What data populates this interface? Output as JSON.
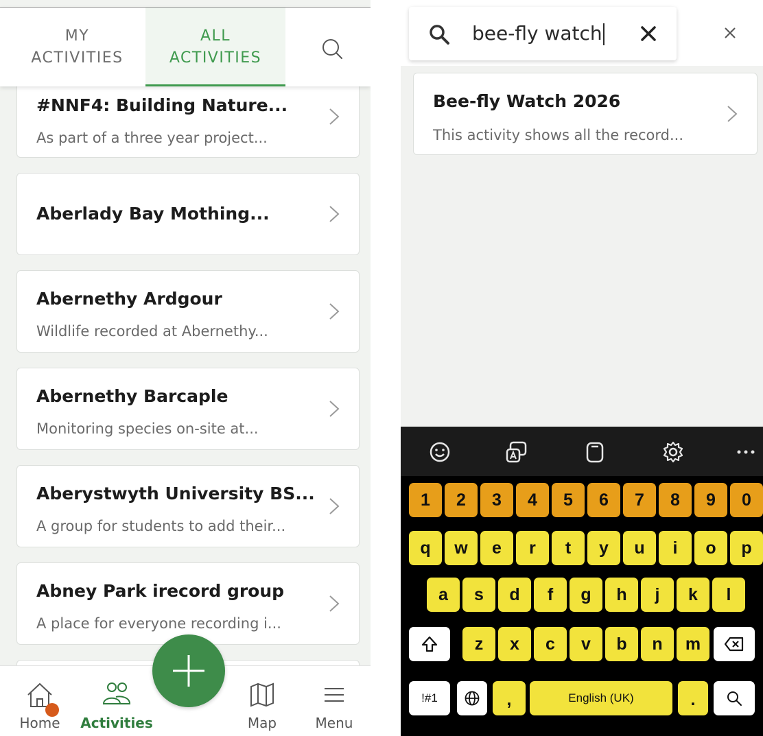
{
  "left": {
    "tabs": {
      "my_line1": "MY",
      "my_line2": "ACTIVITIES",
      "all_line1": "ALL",
      "all_line2": "ACTIVITIES"
    },
    "activities": [
      {
        "title": "#NNF4: Building Nature...",
        "desc": "As part of a three year project..."
      },
      {
        "title": "Aberlady Bay Mothing...",
        "desc": ""
      },
      {
        "title": "Abernethy Ardgour",
        "desc": "Wildlife recorded at Abernethy..."
      },
      {
        "title": "Abernethy Barcaple",
        "desc": "Monitoring species on-site at..."
      },
      {
        "title": "Aberystwyth University BS...",
        "desc": "A group for students to add their..."
      },
      {
        "title": "Abney Park irecord group",
        "desc": "A place for everyone recording i..."
      }
    ],
    "nav": {
      "home": "Home",
      "activities": "Activities",
      "map": "Map",
      "menu": "Menu"
    },
    "icons": {
      "search": "search-icon",
      "chevron": "chevron-right-icon",
      "home": "home-icon",
      "activities": "people-icon",
      "add": "plus-icon",
      "map": "map-icon",
      "menu": "hamburger-icon"
    },
    "colors": {
      "accent": "#3f9a4e",
      "fab": "#3e8c4a",
      "badge": "#d65a1b"
    }
  },
  "right": {
    "search": {
      "value": "bee-fly watch"
    },
    "results": [
      {
        "title": "Bee-fly Watch 2026",
        "desc": "This activity shows all the record..."
      }
    ],
    "keyboard": {
      "numbers": [
        "1",
        "2",
        "3",
        "4",
        "5",
        "6",
        "7",
        "8",
        "9",
        "0"
      ],
      "row1": [
        "q",
        "w",
        "e",
        "r",
        "t",
        "y",
        "u",
        "i",
        "o",
        "p"
      ],
      "row2": [
        "a",
        "s",
        "d",
        "f",
        "g",
        "h",
        "j",
        "k",
        "l"
      ],
      "row3": [
        "z",
        "x",
        "c",
        "v",
        "b",
        "n",
        "m"
      ],
      "symbols_key": "!#1",
      "comma_key": ",",
      "space_key": "English (UK)",
      "period_key": ".",
      "toolbar_icons": [
        "emoji-icon",
        "translate-icon",
        "clipboard-icon",
        "settings-icon",
        "more-icon"
      ],
      "colors": {
        "number_keys": "#e79e1a",
        "letter_keys": "#f2e33c",
        "background": "#000000"
      }
    }
  }
}
